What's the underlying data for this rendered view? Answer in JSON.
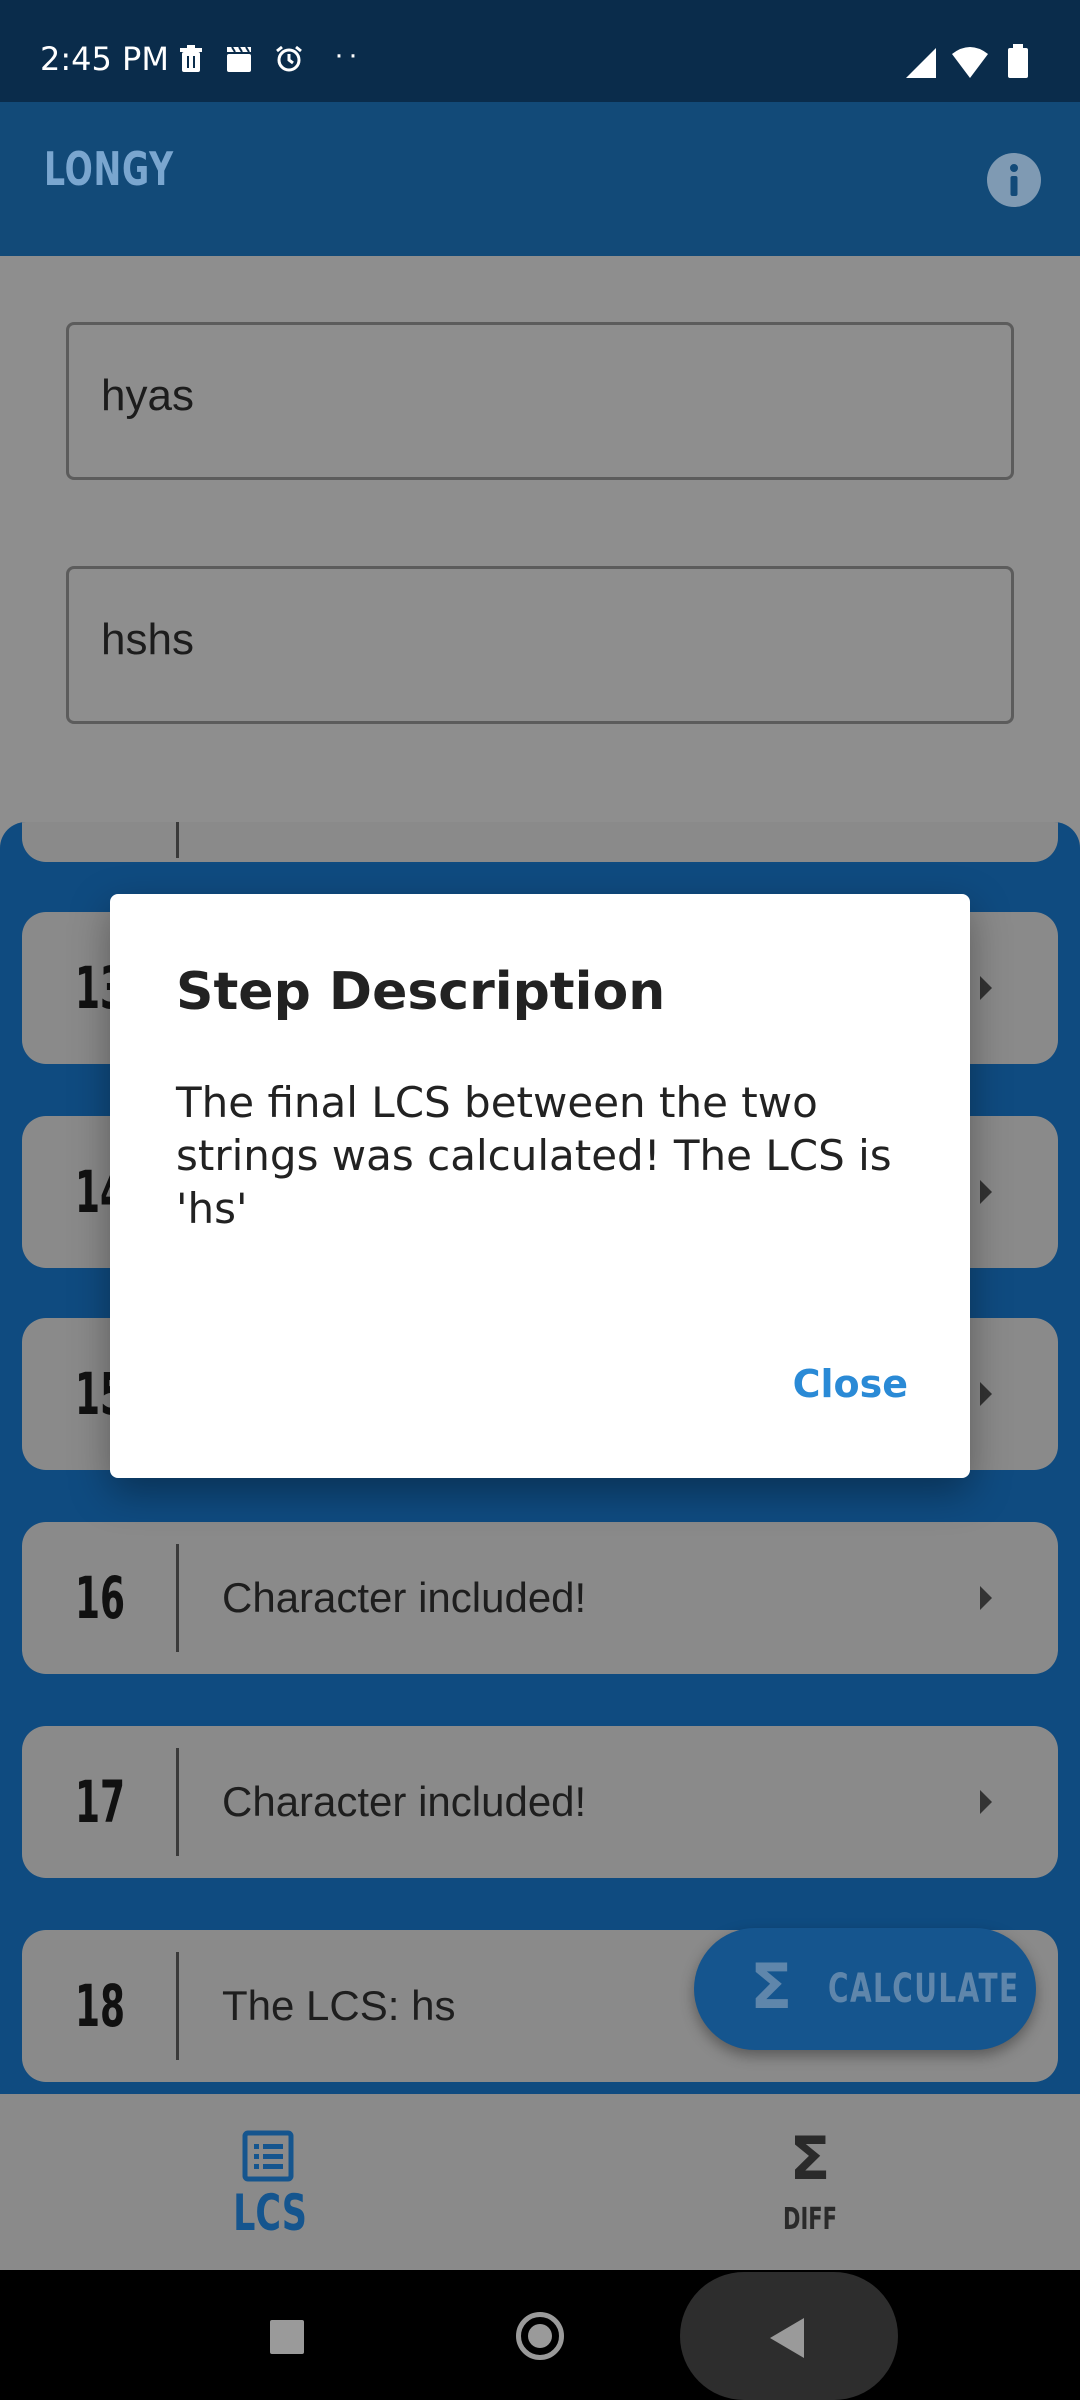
{
  "status_bar": {
    "time": "2:45 PM",
    "dots": "··"
  },
  "app": {
    "title": "LONGY"
  },
  "inputs": {
    "first_string": "hyas",
    "second_string": "hshs"
  },
  "steps": [
    {
      "number": "16",
      "text": "Character included!"
    },
    {
      "number": "17",
      "text": "Character included!"
    },
    {
      "number": "18",
      "text": "The LCS: hs"
    }
  ],
  "partial_steps": [
    {
      "number": "13"
    },
    {
      "number": "14"
    },
    {
      "number": "15"
    }
  ],
  "fab": {
    "icon": "Σ",
    "label": "CALCULATE"
  },
  "bottom_nav": {
    "lcs_label": "LCS",
    "diff_icon": "Σ",
    "diff_label": "DIFF"
  },
  "dialog": {
    "title": "Step Description",
    "body": "The final LCS between the two strings was calculated! The LCS is 'hs'",
    "close_label": "Close"
  },
  "colors": {
    "app_bar": "#124a78",
    "accent": "#2a8ad6",
    "panel": "#0f4b80"
  }
}
